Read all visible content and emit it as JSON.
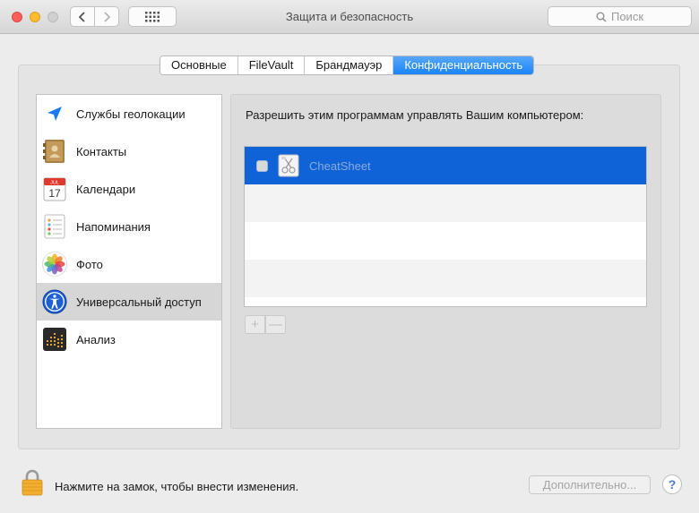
{
  "window": {
    "title": "Защита и безопасность",
    "search_placeholder": "Поиск"
  },
  "tabs": [
    {
      "label": "Основные",
      "active": false
    },
    {
      "label": "FileVault",
      "active": false
    },
    {
      "label": "Брандмауэр",
      "active": false
    },
    {
      "label": "Конфиденциальность",
      "active": true
    }
  ],
  "sidebar": {
    "items": [
      {
        "label": "Службы геолокации",
        "icon": "location-arrow-icon"
      },
      {
        "label": "Контакты",
        "icon": "contacts-book-icon"
      },
      {
        "label": "Календари",
        "icon": "calendar-icon",
        "month": "JUL",
        "day": "17"
      },
      {
        "label": "Напоминания",
        "icon": "reminders-list-icon"
      },
      {
        "label": "Фото",
        "icon": "photos-flower-icon"
      },
      {
        "label": "Универсальный доступ",
        "icon": "accessibility-icon",
        "selected": true
      },
      {
        "label": "Анализ",
        "icon": "analytics-icon"
      }
    ]
  },
  "main": {
    "heading": "Разрешить этим программам управлять Вашим компьютером:",
    "apps": [
      {
        "name": "CheatSheet",
        "checked": false,
        "selected": true
      }
    ],
    "add_label": "+",
    "remove_label": "—"
  },
  "footer": {
    "lock_text": "Нажмите на замок, чтобы внести изменения.",
    "advanced_label": "Дополнительно...",
    "help_label": "?"
  },
  "colors": {
    "accent": "#1a82fb",
    "selection": "#0f63d6"
  }
}
